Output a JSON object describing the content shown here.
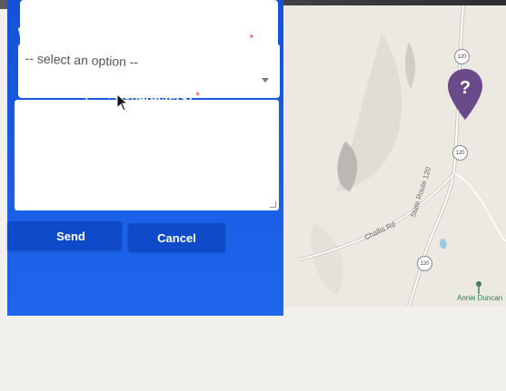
{
  "form": {
    "point_type_label": "What type of point are you adding?",
    "required_mark": "*",
    "select": {
      "selected": "-- select an option --"
    },
    "comment_label": "Comment: (0/500 characters)",
    "comment_value": "",
    "send_label": "Send",
    "cancel_label": "Cancel"
  },
  "map": {
    "road_labels": [
      "Challis Rd",
      "State Route 120"
    ],
    "route_markers": [
      "120",
      "120",
      "120"
    ],
    "place_label": "Annie Duncan",
    "marker_glyph": "?",
    "marker_color": "#6b4a8c"
  },
  "colors": {
    "panel_blue": "#1552d8",
    "button_blue": "#0f4bc9",
    "required_red": "#ff4d4d"
  }
}
